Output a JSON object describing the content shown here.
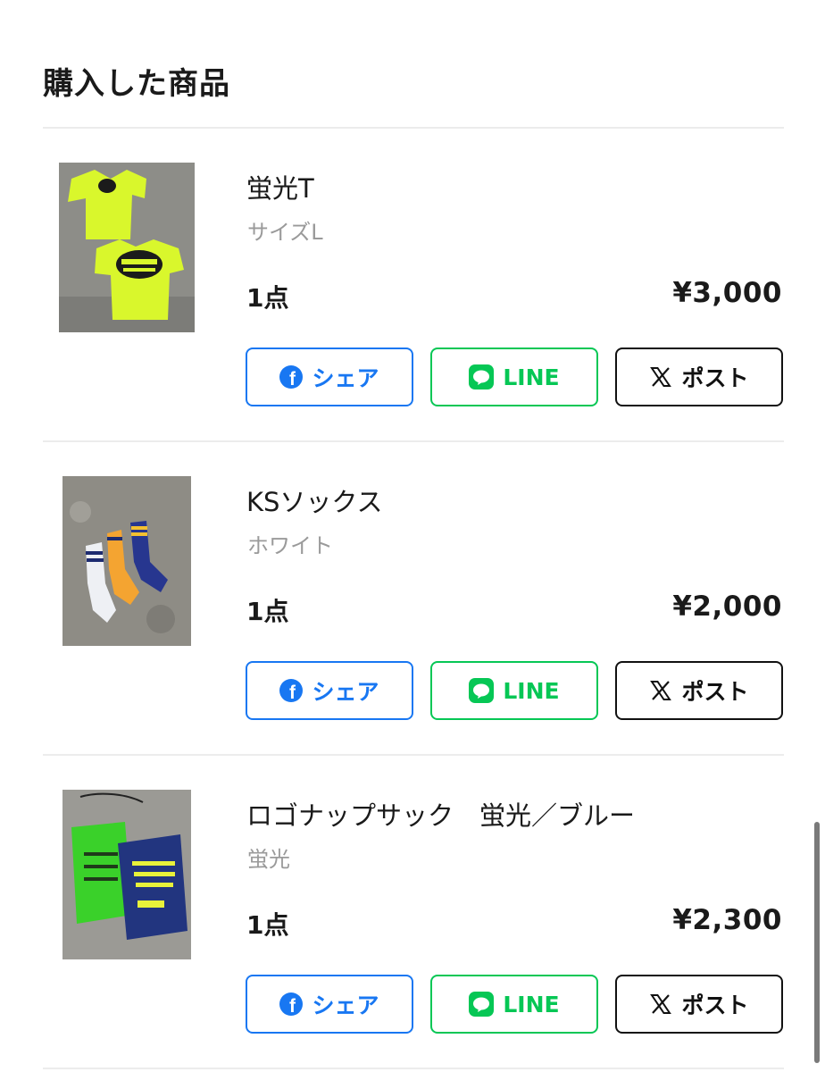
{
  "page": {
    "title": "購入した商品"
  },
  "items": [
    {
      "name": "蛍光T",
      "variant": "サイズL",
      "quantity": "1点",
      "price": "¥3,000",
      "image_desc": "neon-yellow-tshirt"
    },
    {
      "name": "KSソックス",
      "variant": "ホワイト",
      "quantity": "1点",
      "price": "¥2,000",
      "image_desc": "socks-white-orange-navy"
    },
    {
      "name": "ロゴナップサック　蛍光／ブルー",
      "variant": "蛍光",
      "quantity": "1点",
      "price": "¥2,300",
      "image_desc": "drawstring-bags-green-navy"
    }
  ],
  "share": {
    "facebook_label": "シェア",
    "line_label": "LINE",
    "x_label": "ポスト",
    "facebook_color": "#1877f2",
    "line_color": "#06c755",
    "x_color": "#111111",
    "facebook_icon": "facebook-icon",
    "line_icon": "line-icon",
    "x_icon": "x-logo-icon"
  }
}
